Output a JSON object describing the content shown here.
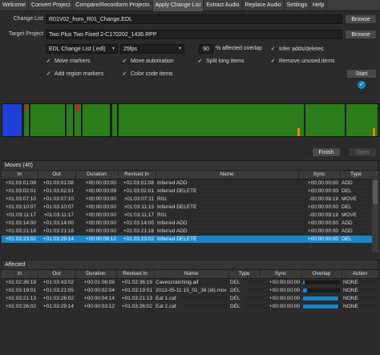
{
  "menu": [
    "Welcome",
    "Convert Project",
    "Compare/Reconform Projects",
    "Apply Change List",
    "Extract Audio",
    "Replace Audio",
    "Settings",
    "Help"
  ],
  "menu_active": 3,
  "change_list": {
    "label": "Change List",
    "value": "R01V02_from_R01_Change.EDL",
    "browse": "Browse"
  },
  "target_project": {
    "label": "Target Project",
    "value": "Two Plus Two Fixed 2-C170202_1436.RPP",
    "browse": "Browse"
  },
  "format_select": "EDL Change List (.edl)",
  "fps_select": "25fps",
  "overlap": {
    "value": "90",
    "label": "% affected overlap"
  },
  "checkboxes": {
    "infer_adds": "Infer adds/deletes",
    "move_markers": "Move markers",
    "move_automation": "Move automation",
    "split_long": "Split long items",
    "remove_unused": "Remove unused items",
    "add_region_markers": "Add region markers",
    "color_code": "Color code items"
  },
  "start_button": "Start",
  "finish_button": "Finish",
  "open_button": "Open",
  "colors": {
    "accent": "#1a86c8",
    "track_green": "#2e8b1e",
    "track_blue": "#1f3fd8",
    "marker_red": "#d42020",
    "marker_orange": "#e08a10"
  },
  "moves": {
    "title": "Moves (40)",
    "columns": [
      "In",
      "Out",
      "Duration",
      "Revised In",
      "Name",
      "Sync",
      "Type"
    ],
    "rows": [
      [
        "+01:03:01:08",
        "+01:03:01:08",
        "+00:00:00:00",
        "+01:03:01:08",
        "Inferred ADD",
        "+00:00:00:00",
        "ADD"
      ],
      [
        "+01:03:02:01",
        "+01:03:02:01",
        "+00:00:00:09",
        "+01:03:02:01",
        "Inferred DELETE",
        "+00:00:00:00",
        "DEL"
      ],
      [
        "+01:03:07:10",
        "+01:03:07:10",
        "+00:00:00:00",
        "+01:03:07:11",
        "R01",
        "-00:00:08:19",
        "MOVE"
      ],
      [
        "+01:03:10:07",
        "+01:03:10:07",
        "+00:00:00:00",
        "+01:03:11:15",
        "Inferred DELETE",
        "+00:00:00:00",
        "DEL"
      ],
      [
        "+01:03:11:17",
        "+01:03:11:17",
        "+00:00:00:00",
        "+01:03:11:17",
        "R01",
        "-00:00:09:19",
        "MOVE"
      ],
      [
        "+01:03:14:00",
        "+01:03:14:00",
        "+00:00:00:00",
        "+01:03:14:00",
        "Inferred ADD",
        "+00:00:00:00",
        "ADD"
      ],
      [
        "+01:03:21:18",
        "+01:03:21:18",
        "+00:00:00:00",
        "+01:03:21:18",
        "Inferred ADD",
        "+00:00:00:00",
        "ADD"
      ],
      [
        "+01:03:23:02",
        "+01:03:29:14",
        "+00:00:06:12",
        "+01:03:23:02",
        "Inferred DELETE",
        "+00:00:00:00",
        "DEL"
      ]
    ],
    "selected_row": 7
  },
  "affected": {
    "title": "Affected",
    "columns": [
      "In",
      "Out",
      "Duration",
      "Revised In",
      "Name",
      "Type",
      "Sync",
      "Overlap",
      "Action"
    ],
    "rows": [
      [
        "+01:02:36:19",
        "+01:03:43:02",
        "+00:01:06:08",
        "+01:02:36:19",
        "Cavescratching.aif",
        "DEL",
        "+00:00:00:00",
        "NONE"
      ],
      [
        "+01:03:19:01",
        "+01:03:21:05",
        "+00:00:02:04",
        "+01:03:19:01",
        "2013-05-11 15_01_38 (id).mov",
        "DEL",
        "+00:00:00:00",
        "NONE"
      ],
      [
        "+01:03:21:13",
        "+01:03:26:02",
        "+00:00:04:14",
        "+01:03:21:13",
        "Eat 1.caf",
        "DEL",
        "+00:00:00:00",
        "NONE"
      ],
      [
        "+01:03:26:02",
        "+01:03:29:14",
        "+00:00:03:12",
        "+01:03:26:02",
        "Eat 2.caf",
        "DEL",
        "+00:00:00:00",
        "NONE"
      ]
    ],
    "overlap_fractions": [
      0.05,
      0.1,
      0.95,
      0.95
    ]
  }
}
